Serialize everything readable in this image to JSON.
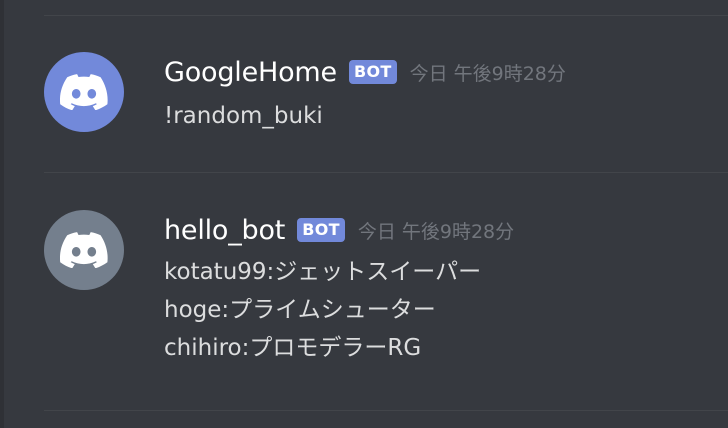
{
  "colors": {
    "background": "#36393f",
    "divider": "#42454a",
    "username": "#ffffff",
    "message_text": "#dcddde",
    "timestamp": "#72767d",
    "bot_tag": "#7289da",
    "avatar_googlehome": "#7289da",
    "avatar_hellobot": "#747f8d"
  },
  "messages": [
    {
      "author": "GoogleHome",
      "tag": "BOT",
      "timestamp": "今日 午後9時28分",
      "avatar_icon": "discord-logo-icon",
      "lines": [
        "!random_buki"
      ]
    },
    {
      "author": "hello_bot",
      "tag": "BOT",
      "timestamp": "今日 午後9時28分",
      "avatar_icon": "discord-logo-icon",
      "lines": [
        "kotatu99:ジェットスイーパー",
        "hoge:プライムシューター",
        "chihiro:プロモデラーRG"
      ]
    }
  ]
}
